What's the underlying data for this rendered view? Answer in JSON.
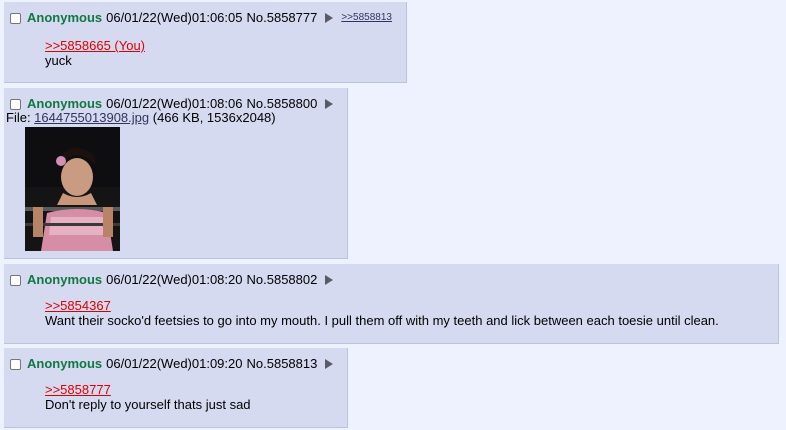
{
  "posts": [
    {
      "name": "Anonymous",
      "datetime": "06/01/22(Wed)01:06:05",
      "postnum": "No.5858777",
      "backlink": ">>5858813",
      "quote": ">>5858665 (You)",
      "text": "yuck"
    },
    {
      "name": "Anonymous",
      "datetime": "06/01/22(Wed)01:08:06",
      "postnum": "No.5858800",
      "file_label": "File: ",
      "file_name": "1644755013908.jpg",
      "file_meta": " (466 KB, 1536x2048)"
    },
    {
      "name": "Anonymous",
      "datetime": "06/01/22(Wed)01:08:20",
      "postnum": "No.5858802",
      "quote": ">>5854367",
      "text": "Want their socko'd feetsies to go into my mouth. I pull them off with my teeth and lick between each toesie until clean."
    },
    {
      "name": "Anonymous",
      "datetime": "06/01/22(Wed)01:09:20",
      "postnum": "No.5858813",
      "quote": ">>5858777",
      "text": "Don't reply to yourself thats just sad"
    }
  ],
  "colors": {
    "page_bg": "#eef2ff",
    "post_bg": "#d6daf0",
    "post_border": "#b7c5d9",
    "name": "#117743",
    "quote": "#dd0000",
    "link": "#34345c"
  },
  "icons": {
    "checkbox": "checkbox-icon",
    "menu": "triangle-right-icon"
  }
}
